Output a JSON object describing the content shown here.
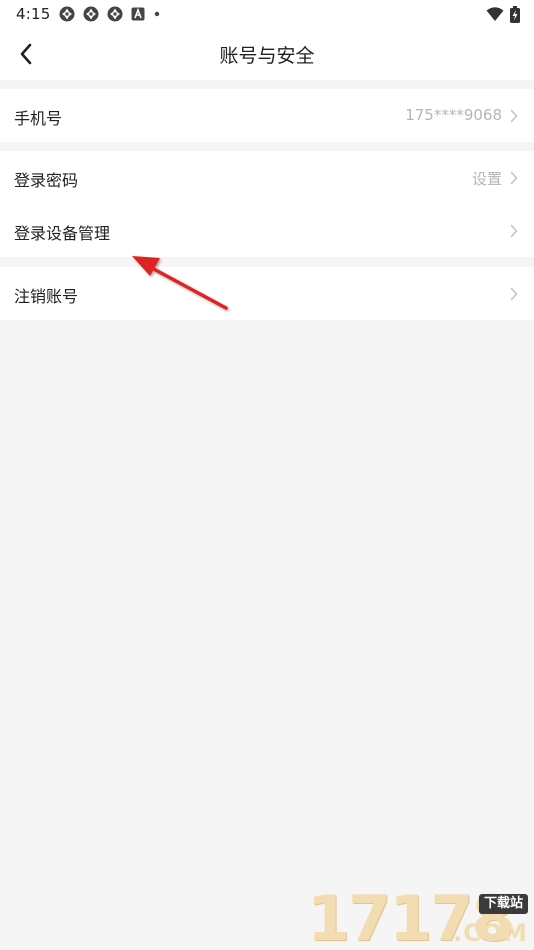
{
  "status_bar": {
    "time": "4:15",
    "notification_icons": [
      "sync-icon",
      "sync-icon",
      "sync-icon",
      "app-a-icon",
      "dot-icon"
    ],
    "wifi_icon": "wifi-icon",
    "battery_icon": "battery-charging-icon"
  },
  "header": {
    "back_icon": "chevron-left-icon",
    "title": "账号与安全"
  },
  "groups": [
    {
      "rows": [
        {
          "label": "手机号",
          "value": "175****9068",
          "icon": "chevron-right-icon"
        }
      ]
    },
    {
      "rows": [
        {
          "label": "登录密码",
          "value": "设置",
          "icon": "chevron-right-icon"
        },
        {
          "label": "登录设备管理",
          "value": "",
          "icon": "chevron-right-icon"
        }
      ]
    },
    {
      "rows": [
        {
          "label": "注销账号",
          "value": "",
          "icon": "chevron-right-icon"
        }
      ]
    }
  ],
  "annotation": {
    "type": "arrow",
    "color": "#e02020",
    "points_to": "登录设备管理"
  },
  "watermark": {
    "digits": "17178",
    "tag": "下载站",
    "suffix": ".COM"
  },
  "colors": {
    "background": "#f5f5f5",
    "surface": "#ffffff",
    "text_primary": "#222222",
    "text_secondary": "#b5b5b5",
    "chevron": "#c4c4c4"
  }
}
